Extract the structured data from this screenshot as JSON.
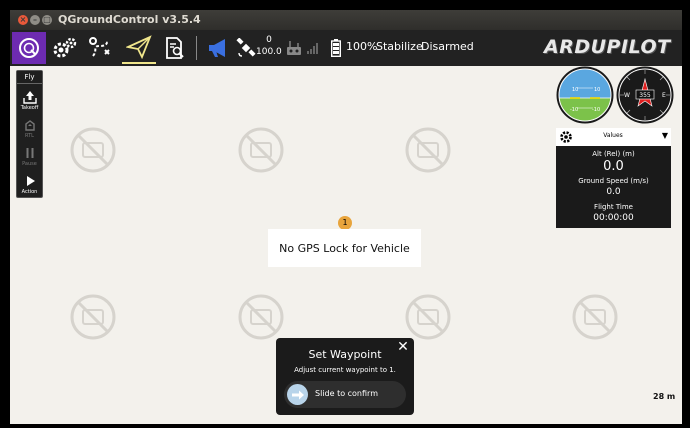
{
  "window": {
    "title": "QGroundControl v3.5.4",
    "close_glyph": "×",
    "min_glyph": "–",
    "max_glyph": "□"
  },
  "toolbar": {
    "icons": [
      "qgc-logo-icon",
      "gear-icon",
      "plan-route-icon",
      "paper-plane-icon",
      "analyze-icon",
      "megaphone-icon",
      "satellite-icon",
      "rc-transmitter-icon",
      "signal-bars-icon",
      "battery-icon"
    ],
    "gps_count": "0",
    "gps_hdop": "100.0",
    "battery": "100%",
    "flight_mode": "Stabilize",
    "arm_status": "Disarmed",
    "brand_a": "ARDU",
    "brand_b": "PILOT",
    "fly_accent": "#f0e68c",
    "qgc_color": "#6d2bb1",
    "megaphone_color": "#3a6fe0"
  },
  "fly_tools": {
    "header": "Fly",
    "takeoff": "Takeoff",
    "rtl": "RTL",
    "pause": "Pause",
    "action": "Action"
  },
  "instrument": {
    "pitch_upper": "10",
    "pitch_lower_left": "-10",
    "pitch_lower_right": "-10",
    "pitch_mid_right": "10",
    "heading": "355",
    "compass_w": "W",
    "compass_e": "E"
  },
  "values_panel": {
    "title": "Values",
    "caret": "▼",
    "alt_label": "Alt (Rel) (m)",
    "alt_value": "0.0",
    "speed_label": "Ground Speed (m/s)",
    "speed_value": "0.0",
    "time_label": "Flight Time",
    "time_value": "00:00:00"
  },
  "gps_notice": {
    "count": "1",
    "text": "No GPS Lock for Vehicle"
  },
  "waypoint_dialog": {
    "title": "Set Waypoint",
    "close_glyph": "✕",
    "message": "Adjust current waypoint to 1.",
    "slider_label": "Slide to confirm"
  },
  "map": {
    "scale": "28 m"
  }
}
